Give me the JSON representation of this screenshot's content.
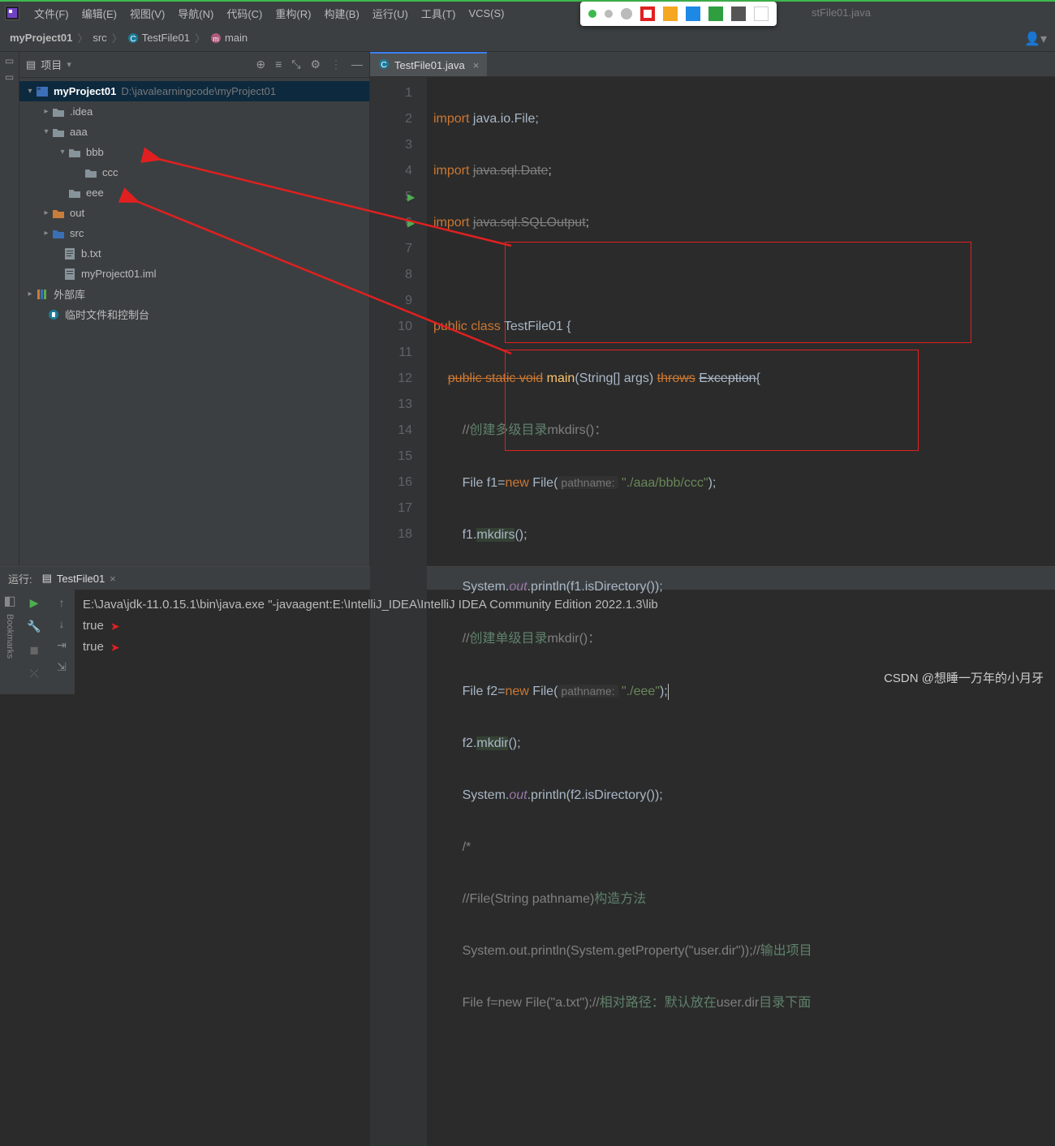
{
  "menu": {
    "file": "文件(F)",
    "edit": "编辑(E)",
    "view": "视图(V)",
    "nav": "导航(N)",
    "code": "代码(C)",
    "refactor": "重构(R)",
    "build": "构建(B)",
    "run": "运行(U)",
    "tools": "工具(T)",
    "vcs": "VCS(S)"
  },
  "hidden_tab": "stFile01.java",
  "breadcrumb": {
    "project": "myProject01",
    "src": "src",
    "cls": "TestFile01",
    "method": "main"
  },
  "project_panel": {
    "title": "项目"
  },
  "tree": {
    "root": {
      "name": "myProject01",
      "path": "D:\\javalearningcode\\myProject01"
    },
    "idea": ".idea",
    "aaa": "aaa",
    "bbb": "bbb",
    "ccc": "ccc",
    "eee": "eee",
    "out": "out",
    "src": "src",
    "btxt": "b.txt",
    "iml": "myProject01.iml",
    "extlib": "外部库",
    "scratch": "临时文件和控制台"
  },
  "editor": {
    "tab": "TestFile01.java"
  },
  "code": {
    "l1": "import java.io.File;",
    "l2": "import java.sql.Date;",
    "l3": "import java.sql.SQLOutput;",
    "l5_pre": "public class ",
    "l5_cls": "TestFile01",
    "l5_post": " {",
    "l6_a": "public static void ",
    "l6_m": "main",
    "l6_b": "(String[] args) ",
    "l6_t": "throws ",
    "l6_e": "Exception",
    "l6_c": "{",
    "l7": "//创建多级目录mkdirs()：",
    "l8_a": "File f1=",
    "l8_n": "new",
    "l8_b": " File(",
    "l8_h": "pathname:",
    "l8_s": " \"./aaa/bbb/ccc\"",
    "l8_c": ");",
    "l9_a": "f1.",
    "l9_m": "mkdirs",
    "l9_b": "();",
    "l10_a": "System.",
    "l10_o": "out",
    "l10_b": ".println(f1.isDirectory());",
    "l11": "//创建单级目录mkdir()：",
    "l12_a": "File f2=",
    "l12_n": "new",
    "l12_b": " File(",
    "l12_h": "pathname:",
    "l12_s": " \"./eee\"",
    "l12_c": ");",
    "l13_a": "f2.",
    "l13_m": "mkdir",
    "l13_b": "();",
    "l14_a": "System.",
    "l14_o": "out",
    "l14_b": ".println(f2.isDirectory());",
    "l15": "/*",
    "l16": "//File(String pathname)构造方法",
    "l17": "System.out.println(System.getProperty(\"user.dir\"));//输出项目",
    "l18": "File f=new File(\"a.txt\");//相对路径：默认放在user.dir目录下面"
  },
  "run": {
    "label": "运行:",
    "tab": "TestFile01"
  },
  "console": {
    "cmd": "E:\\Java\\jdk-11.0.15.1\\bin\\java.exe \"-javaagent:E:\\IntelliJ_IDEA\\IntelliJ IDEA Community Edition 2022.1.3\\lib",
    "l1": "true",
    "l2": "true"
  },
  "watermark": "CSDN @想睡一万年的小月牙",
  "bookmarks": "Bookmarks"
}
